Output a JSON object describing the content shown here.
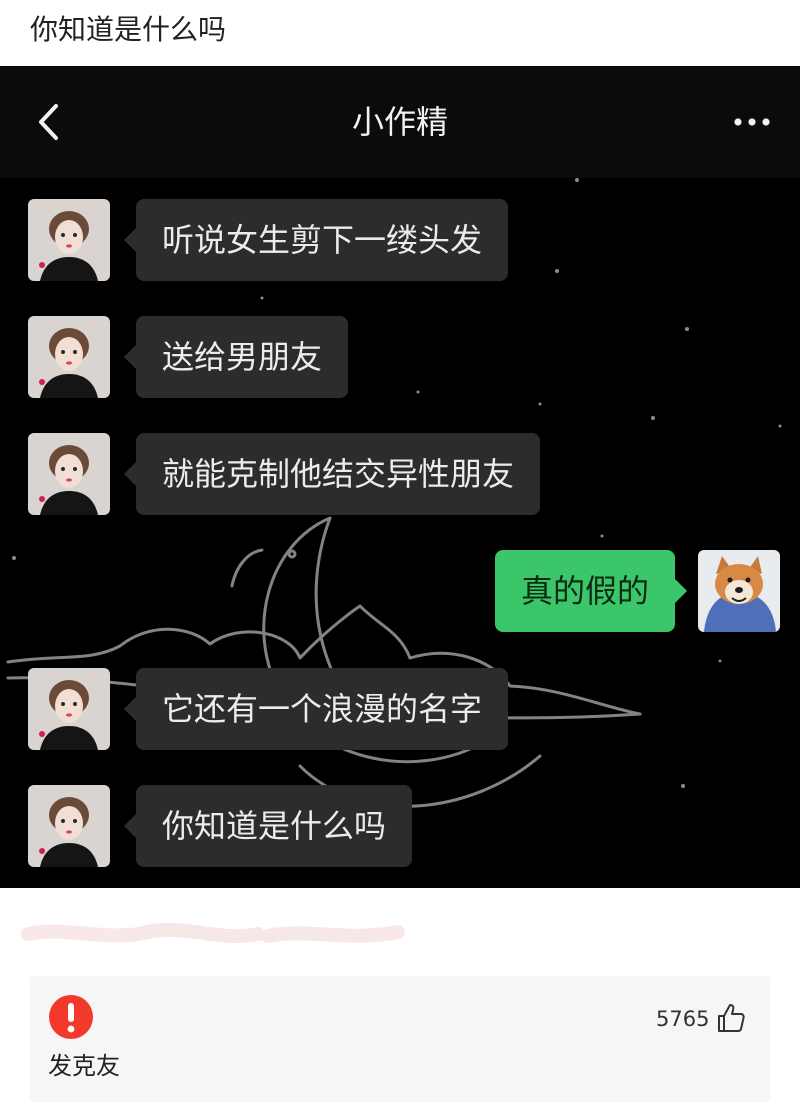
{
  "post": {
    "title": "你知道是什么吗"
  },
  "chat": {
    "contact_name": "小作精",
    "back_icon": "chevron-left-icon",
    "more_icon": "ellipsis-icon",
    "incoming_bubble_color": "#2c2c2c",
    "outgoing_bubble_color": "#3cc66a",
    "messages": [
      {
        "side": "left",
        "text": "听说女生剪下一缕头发"
      },
      {
        "side": "left",
        "text": "送给男朋友"
      },
      {
        "side": "left",
        "text": "就能克制他结交异性朋友"
      },
      {
        "side": "right",
        "text": "真的假的"
      },
      {
        "side": "left",
        "text": "它还有一个浪漫的名字"
      },
      {
        "side": "left",
        "text": "你知道是什么吗"
      }
    ]
  },
  "comment": {
    "text": "发克友",
    "likes": "5765",
    "avatar_icon": "exclamation-circle-icon",
    "like_icon": "thumbs-up-icon",
    "accent_color": "#f2392c"
  }
}
